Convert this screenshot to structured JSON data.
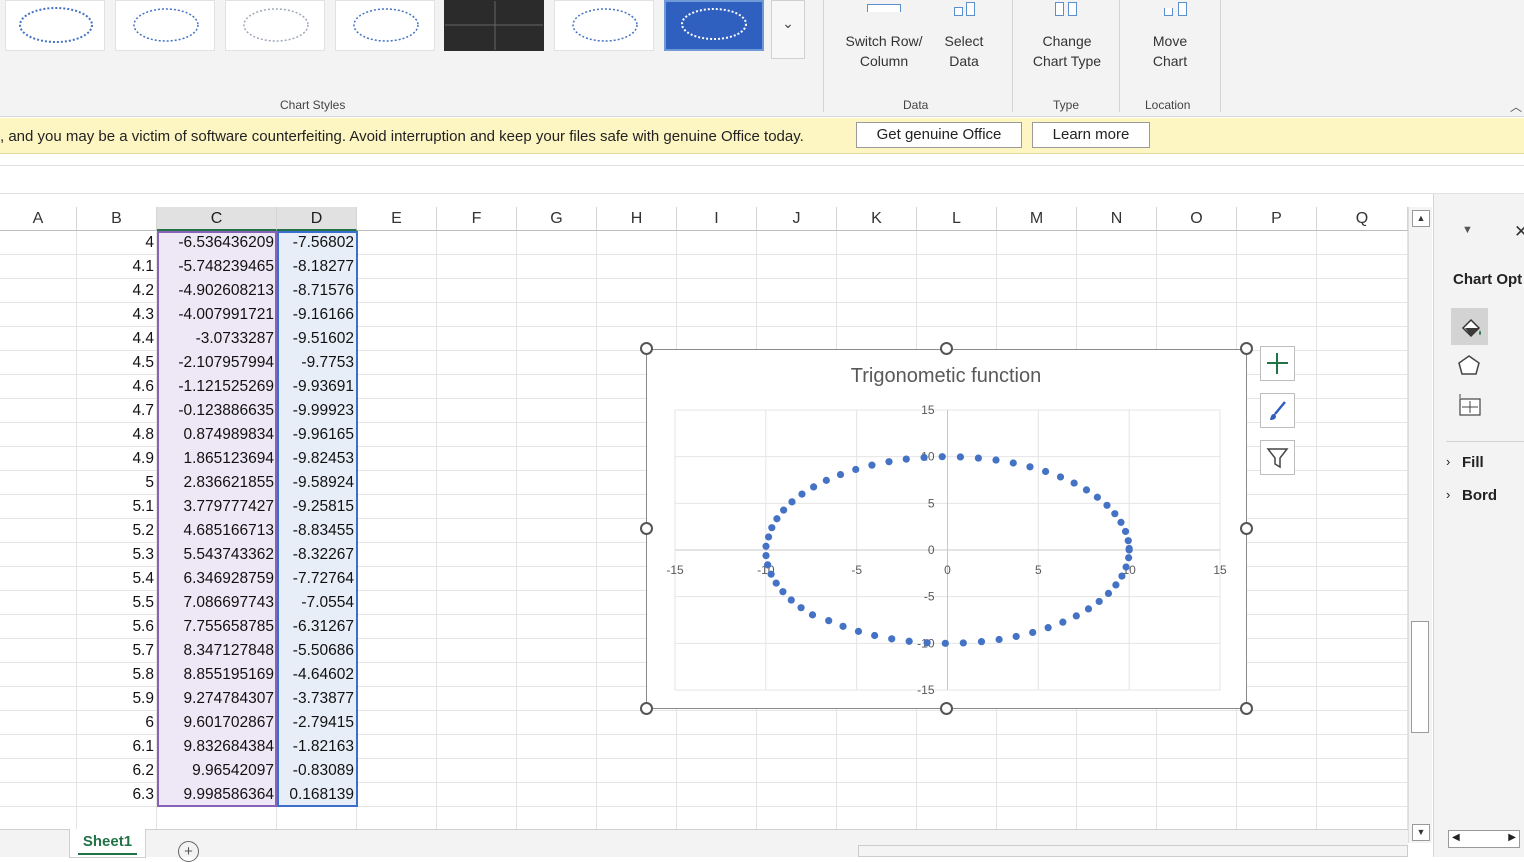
{
  "ribbon": {
    "chart_styles_label": "Chart Styles",
    "data_group_label": "Data",
    "type_group_label": "Type",
    "location_group_label": "Location",
    "switch_row_col": [
      "Switch Row/",
      "Column"
    ],
    "select_data": [
      "Select",
      "Data"
    ],
    "change_chart_type": [
      "Change",
      "Chart Type"
    ],
    "move_chart": [
      "Move",
      "Chart"
    ],
    "styles_more_icon": "chevron-down-icon",
    "collapse_icon": "chevron-up-icon"
  },
  "notice": {
    "message": ", and you may be a victim of software counterfeiting. Avoid interruption and keep your files safe with genuine Office today.",
    "get_genuine": "Get genuine Office",
    "learn_more": "Learn more"
  },
  "columns": [
    "A",
    "B",
    "C",
    "D",
    "E",
    "F",
    "G",
    "H",
    "I",
    "J",
    "K",
    "L",
    "M",
    "N",
    "O",
    "P",
    "Q"
  ],
  "rows": [
    {
      "b": "4",
      "c": "-6.536436209",
      "d": "-7.56802"
    },
    {
      "b": "4.1",
      "c": "-5.748239465",
      "d": "-8.18277"
    },
    {
      "b": "4.2",
      "c": "-4.902608213",
      "d": "-8.71576"
    },
    {
      "b": "4.3",
      "c": "-4.007991721",
      "d": "-9.16166"
    },
    {
      "b": "4.4",
      "c": "-3.0733287",
      "d": "-9.51602"
    },
    {
      "b": "4.5",
      "c": "-2.107957994",
      "d": "-9.7753"
    },
    {
      "b": "4.6",
      "c": "-1.121525269",
      "d": "-9.93691"
    },
    {
      "b": "4.7",
      "c": "-0.123886635",
      "d": "-9.99923"
    },
    {
      "b": "4.8",
      "c": "0.874989834",
      "d": "-9.96165"
    },
    {
      "b": "4.9",
      "c": "1.865123694",
      "d": "-9.82453"
    },
    {
      "b": "5",
      "c": "2.836621855",
      "d": "-9.58924"
    },
    {
      "b": "5.1",
      "c": "3.779777427",
      "d": "-9.25815"
    },
    {
      "b": "5.2",
      "c": "4.685166713",
      "d": "-8.83455"
    },
    {
      "b": "5.3",
      "c": "5.543743362",
      "d": "-8.32267"
    },
    {
      "b": "5.4",
      "c": "6.346928759",
      "d": "-7.72764"
    },
    {
      "b": "5.5",
      "c": "7.086697743",
      "d": "-7.0554"
    },
    {
      "b": "5.6",
      "c": "7.755658785",
      "d": "-6.31267"
    },
    {
      "b": "5.7",
      "c": "8.347127848",
      "d": "-5.50686"
    },
    {
      "b": "5.8",
      "c": "8.855195169",
      "d": "-4.64602"
    },
    {
      "b": "5.9",
      "c": "9.274784307",
      "d": "-3.73877"
    },
    {
      "b": "6",
      "c": "9.601702867",
      "d": "-2.79415"
    },
    {
      "b": "6.1",
      "c": "9.832684384",
      "d": "-1.82163"
    },
    {
      "b": "6.2",
      "c": "9.96542097",
      "d": "-0.83089"
    },
    {
      "b": "6.3",
      "c": "9.998586364",
      "d": "0.168139"
    }
  ],
  "sheet": {
    "tab_name": "Sheet1",
    "add_icon": "plus-circle-icon"
  },
  "task_pane": {
    "title": "Chart Opt",
    "fill": "Fill",
    "border": "Bord",
    "icons": [
      "fill-line-icon",
      "effects-icon",
      "size-properties-icon"
    ]
  },
  "chart_buttons": [
    "plus-icon",
    "brush-icon",
    "filter-icon"
  ],
  "chart_data": {
    "type": "scatter",
    "title": "Trigonometic function",
    "xlim": [
      -15,
      15
    ],
    "ylim": [
      -15,
      15
    ],
    "xticks": [
      "-15",
      "-10",
      "-5",
      "0",
      "5",
      "10",
      "15"
    ],
    "yticks": [
      "15",
      "10",
      "5",
      "0",
      "-5",
      "-10",
      "-15"
    ],
    "grid": true,
    "marker_color": "#4472c4",
    "series": [
      {
        "x": [
          10,
          9.95,
          9.8,
          9.55,
          9.21,
          8.78,
          8.25,
          7.65,
          6.97,
          6.22,
          5.4,
          4.54,
          3.62,
          2.67,
          1.7,
          0.71,
          -0.29,
          -1.29,
          -2.27,
          -3.22,
          -4.16,
          -5.05,
          -5.89,
          -6.67,
          -7.37,
          -8.01,
          -8.56,
          -9.02,
          -9.39,
          -9.67,
          -9.85,
          -9.99,
          -9.99,
          -9.9,
          -9.71,
          -9.43,
          -9.06,
          -8.6,
          -8.06,
          -7.43,
          -6.54,
          -5.75,
          -4.9,
          -4.01,
          -3.07,
          -2.11,
          -1.12,
          -0.12,
          0.87,
          1.87,
          2.84,
          3.78,
          4.69,
          5.54,
          6.35,
          7.09,
          7.76,
          8.35,
          8.86,
          9.27,
          9.6,
          9.83,
          9.97,
          10
        ],
        "y": [
          0,
          1,
          1.99,
          2.96,
          3.89,
          4.79,
          5.65,
          6.44,
          7.17,
          7.83,
          8.41,
          8.91,
          9.32,
          9.64,
          9.85,
          9.97,
          10,
          9.92,
          9.74,
          9.46,
          9.09,
          8.63,
          8.08,
          7.46,
          6.76,
          5.99,
          5.16,
          4.28,
          3.35,
          2.39,
          1.4,
          0.4,
          -0.6,
          -1.59,
          -2.59,
          -3.55,
          -4.47,
          -5.36,
          -6.18,
          -6.95,
          -7.57,
          -8.18,
          -8.72,
          -9.16,
          -9.52,
          -9.78,
          -9.94,
          -10,
          -9.96,
          -9.82,
          -9.59,
          -9.26,
          -8.83,
          -8.32,
          -7.73,
          -7.06,
          -6.31,
          -5.51,
          -4.65,
          -3.74,
          -2.79,
          -1.82,
          -0.83,
          0.17
        ]
      }
    ]
  }
}
